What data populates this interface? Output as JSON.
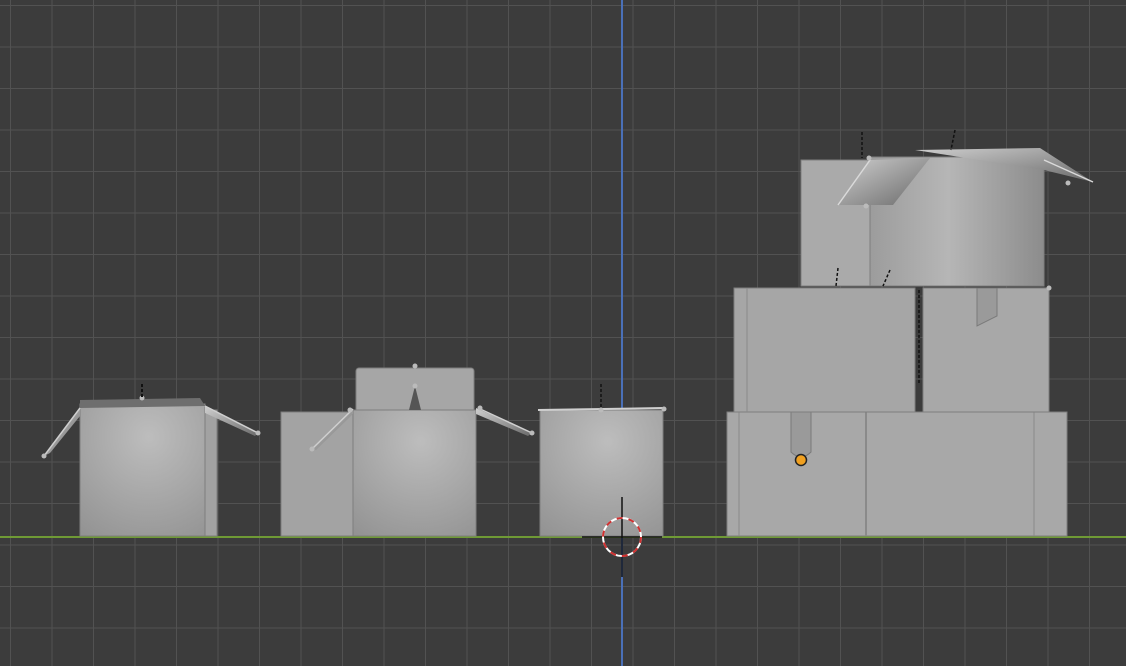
{
  "viewport": {
    "mode": "3d-viewport-front-orthographic",
    "grid_visible": true,
    "colors": {
      "background": "#3c3c3c",
      "grid_line": "#525252",
      "ground_axis": "#6f9a35",
      "vertical_axis": "#4a70b8",
      "box_face": "#a8a8a8",
      "box_shadow": "#8a8a8a",
      "origin_dot": "#f0a020",
      "cursor_ring": "#d03030"
    },
    "objects": [
      {
        "name": "box-open-small"
      },
      {
        "name": "box-open-wide"
      },
      {
        "name": "box-closed"
      },
      {
        "name": "box-stack"
      }
    ]
  }
}
